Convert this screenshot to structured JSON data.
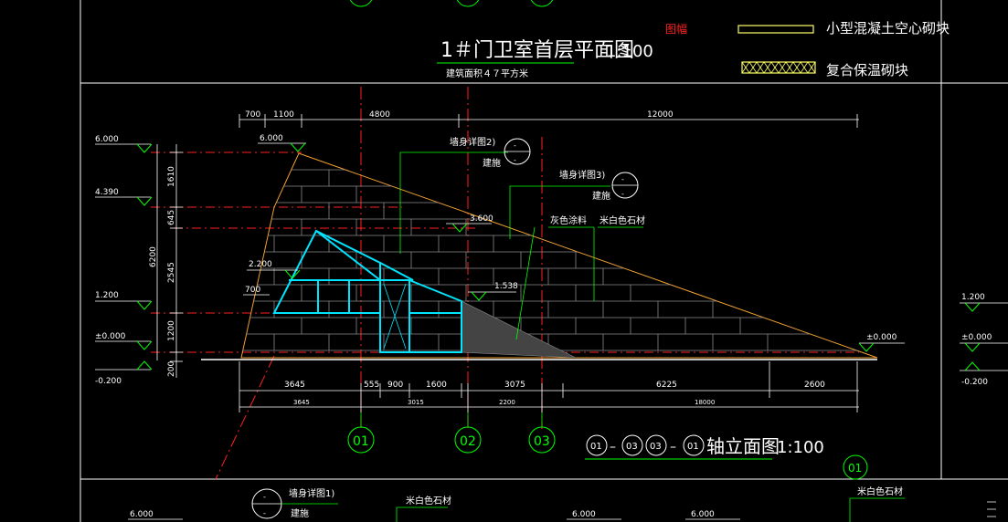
{
  "colors": {
    "background": "#000000",
    "white": "#ffffff",
    "green": "#00ff00",
    "cyan": "#00e5ff",
    "red": "#ff2020",
    "yellow": "#ffff66",
    "orange": "#f0a030",
    "grey": "#bdbdbd"
  },
  "title": {
    "main": "1＃门卫室首层平面图",
    "scale": "1:100",
    "area": "建筑面积４７平方米",
    "flag": "图幅"
  },
  "legend": {
    "block": "小型混凝土空心砌块",
    "insulation": "复合保温砌块"
  },
  "top_dims": [
    "700",
    "1100",
    "4800",
    "12000"
  ],
  "levels_left": [
    "6.000",
    "4.390",
    "1.200",
    "±0.000",
    "-0.200"
  ],
  "levels_right": [
    "1.200",
    "±0.000",
    "-0.200"
  ],
  "vertical_dims": [
    "1610",
    "645",
    "2545",
    "1200",
    "200",
    "6200"
  ],
  "inner_levels": [
    "6.000",
    "3.600",
    "2.200",
    "1.538",
    "±0.000",
    "700"
  ],
  "callouts": {
    "detail2": "墙身详图2)",
    "detail3": "墙身详图3)",
    "detail1": "墙身详图1)",
    "jianshi": "建施",
    "grey_paint": "灰色涂料",
    "white_stone": "米白色石材",
    "dash": "-"
  },
  "bottom_dims_1": [
    "3645",
    "555",
    "900",
    "1600",
    "3075",
    "6225",
    "2600"
  ],
  "bottom_dims_2": [
    "3645",
    "3015",
    "2200",
    "18000"
  ],
  "axes": [
    "01",
    "02",
    "03"
  ],
  "elevation_title": {
    "a": "01",
    "b": "03",
    "c": "03",
    "d": "01",
    "dash": "–",
    "label": "轴立面图",
    "scale": "1:100"
  },
  "bottom_axis": "01",
  "lower_labels": {
    "detail1": "墙身详图1)",
    "jianshi": "建施",
    "white_stone_a": "米白色石材",
    "white_stone_b": "米白色石材",
    "lvl_a": "6.000",
    "lvl_b": "6.000",
    "lvl_c": "6.000"
  },
  "top_axes": [
    "01",
    "02",
    "03"
  ]
}
